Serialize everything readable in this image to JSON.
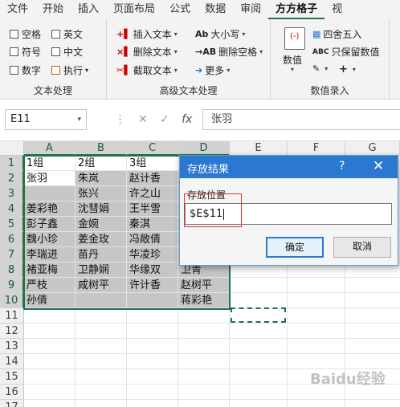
{
  "ribbon_tabs": [
    "文件",
    "开始",
    "插入",
    "页面布局",
    "公式",
    "数据",
    "审阅",
    "方方格子",
    "视"
  ],
  "groups": {
    "text_processing": {
      "title": "文本处理",
      "checkboxes": [
        "空格",
        "英文",
        "符号",
        "中文",
        "数字",
        "执行"
      ]
    },
    "advanced_text": {
      "title": "高级文本处理",
      "commands": [
        "插入文本",
        "大小写",
        "删除文本",
        "删除空格",
        "截取文本",
        "更多"
      ]
    },
    "numeric_entry": {
      "title": "数值录入",
      "big_button": "数值",
      "commands": [
        "四舍五入",
        "只保留数值"
      ]
    }
  },
  "name_box": "E11",
  "formula_bar_value": "张羽",
  "columns": [
    "A",
    "B",
    "C",
    "D",
    "E",
    "F",
    "G"
  ],
  "rows": [
    "1",
    "2",
    "3",
    "4",
    "5",
    "6",
    "7",
    "8",
    "9",
    "10",
    "11",
    "12",
    "13",
    "14",
    "15",
    "16",
    "17"
  ],
  "cells": {
    "A1": "1组",
    "B1": "2组",
    "C1": "3组",
    "A2": "张羽",
    "B2": "朱岚",
    "C2": "赵计香",
    "B3": "张兴",
    "C3": "许之山",
    "A4": "姜彩艳",
    "B4": "沈彗娟",
    "C4": "王半雪",
    "A5": "彭子鑫",
    "B5": "金婉",
    "C5": "秦淇",
    "A6": "魏小珍",
    "B6": "姜金玫",
    "C6": "冯敞倩",
    "A7": "李瑞进",
    "B7": "苗丹",
    "C7": "华凌珍",
    "A8": "褚亚梅",
    "B8": "卫静娴",
    "C8": "华缘双",
    "D8": "卫青",
    "A9": "严枝",
    "B9": "咸树平",
    "C9": "许计香",
    "D9": "赵树平",
    "A10": "孙倩",
    "D10": "蒋彩艳"
  },
  "dialog": {
    "title": "存放结果",
    "help": "?",
    "close": "✕",
    "label": "存放位置",
    "value": "$E$11",
    "ok": "确定",
    "cancel": "取消"
  },
  "watermark": "Baidu经验"
}
